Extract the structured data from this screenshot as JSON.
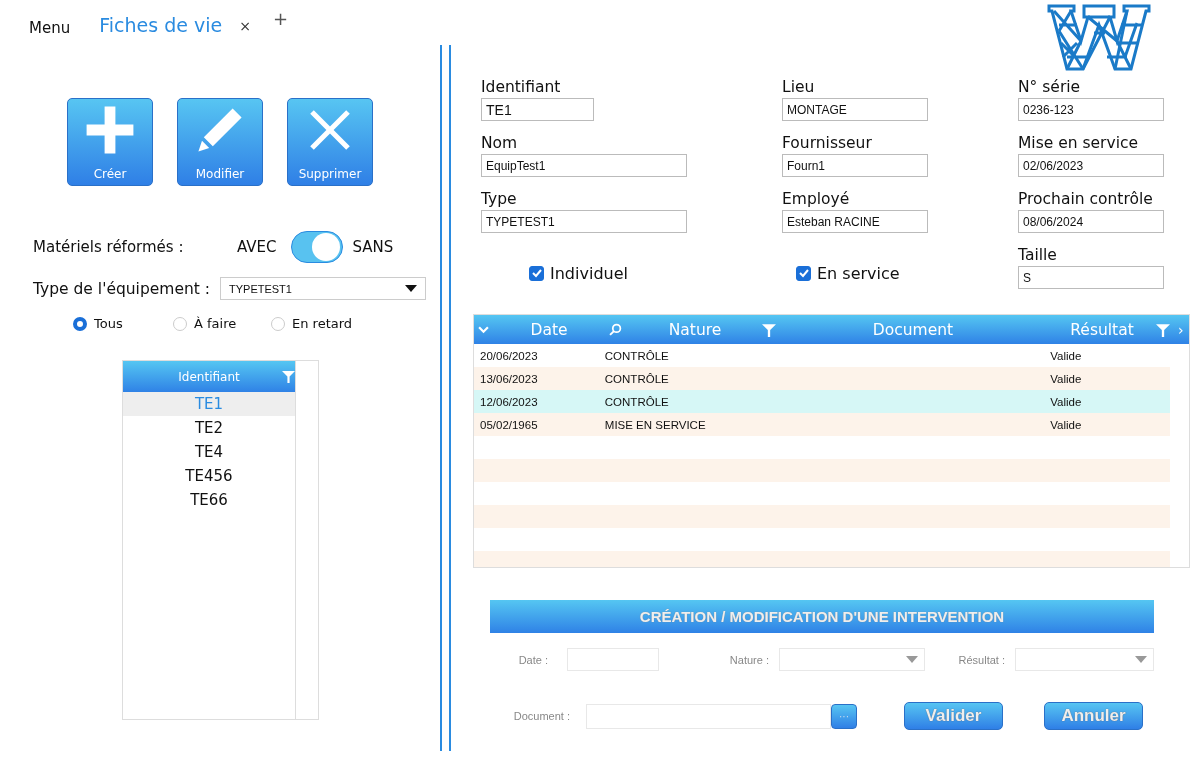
{
  "header": {
    "menu": "Menu",
    "tabs": [
      {
        "label": "Fiches de vie",
        "selected": true,
        "close": "×"
      }
    ],
    "add_tab": "+"
  },
  "actions": [
    {
      "label": "Créer",
      "kind": "plus"
    },
    {
      "label": "Modifier",
      "kind": "pencil"
    },
    {
      "label": "Supprimer",
      "kind": "cross"
    }
  ],
  "reformes": {
    "label": "Matériels réformés :",
    "off_label": "AVEC",
    "on_label": "SANS",
    "on": true
  },
  "equipment_type": {
    "label": "Type de l'équipement  :",
    "value": "TYPETEST1"
  },
  "filters": [
    {
      "label": "Tous",
      "selected": true
    },
    {
      "label": "À faire",
      "selected": false
    },
    {
      "label": "En retard",
      "selected": false
    }
  ],
  "id_list": {
    "column": "Identifiant",
    "items": [
      {
        "label": "TE1",
        "selected": true
      },
      {
        "label": "TE2",
        "selected": false
      },
      {
        "label": "TE4",
        "selected": false
      },
      {
        "label": "TE456",
        "selected": false
      },
      {
        "label": "TE66",
        "selected": false
      }
    ]
  },
  "field_columns": [
    [
      {
        "label": "Identifiant",
        "value": "TE1"
      },
      {
        "label": "Nom",
        "value": "EquipTest1"
      },
      {
        "label": "Type",
        "value": "TYPETEST1"
      }
    ],
    [
      {
        "label": "Lieu",
        "value": "MONTAGE"
      },
      {
        "label": "Fournisseur",
        "value": "Fourn1"
      },
      {
        "label": "Employé",
        "value": "Esteban RACINE"
      }
    ],
    [
      {
        "label": "N° série",
        "value": "0236-123"
      },
      {
        "label": "Mise en service",
        "value": "02/06/2023"
      },
      {
        "label": "Prochain contrôle",
        "value": "08/06/2024"
      },
      {
        "label": "Taille",
        "value": "S"
      }
    ]
  ],
  "checks": [
    {
      "label": "Individuel",
      "checked": true
    },
    {
      "label": "En service",
      "checked": true
    }
  ],
  "table": {
    "columns": [
      "Date",
      "Nature",
      "Document",
      "Résultat"
    ],
    "expand": "›",
    "rows": [
      {
        "date": "20/06/2023",
        "nature": "CONTRÔLE",
        "result": "Valide",
        "selected": false
      },
      {
        "date": "13/06/2023",
        "nature": "CONTRÔLE",
        "result": "Valide",
        "selected": false
      },
      {
        "date": "12/06/2023",
        "nature": "CONTRÔLE",
        "result": "Valide",
        "selected": true
      },
      {
        "date": "05/02/1965",
        "nature": "MISE EN SERVICE",
        "result": "Valide",
        "selected": false
      }
    ]
  },
  "intervention": {
    "title": "CRÉATION / MODIFICATION D'UNE INTERVENTION",
    "date_label": "Date :",
    "nature_label": "Nature :",
    "result_label": "Résultat :",
    "document_label": "Document :",
    "browse": "···",
    "buttons": [
      "Valider",
      "Annuler"
    ]
  }
}
